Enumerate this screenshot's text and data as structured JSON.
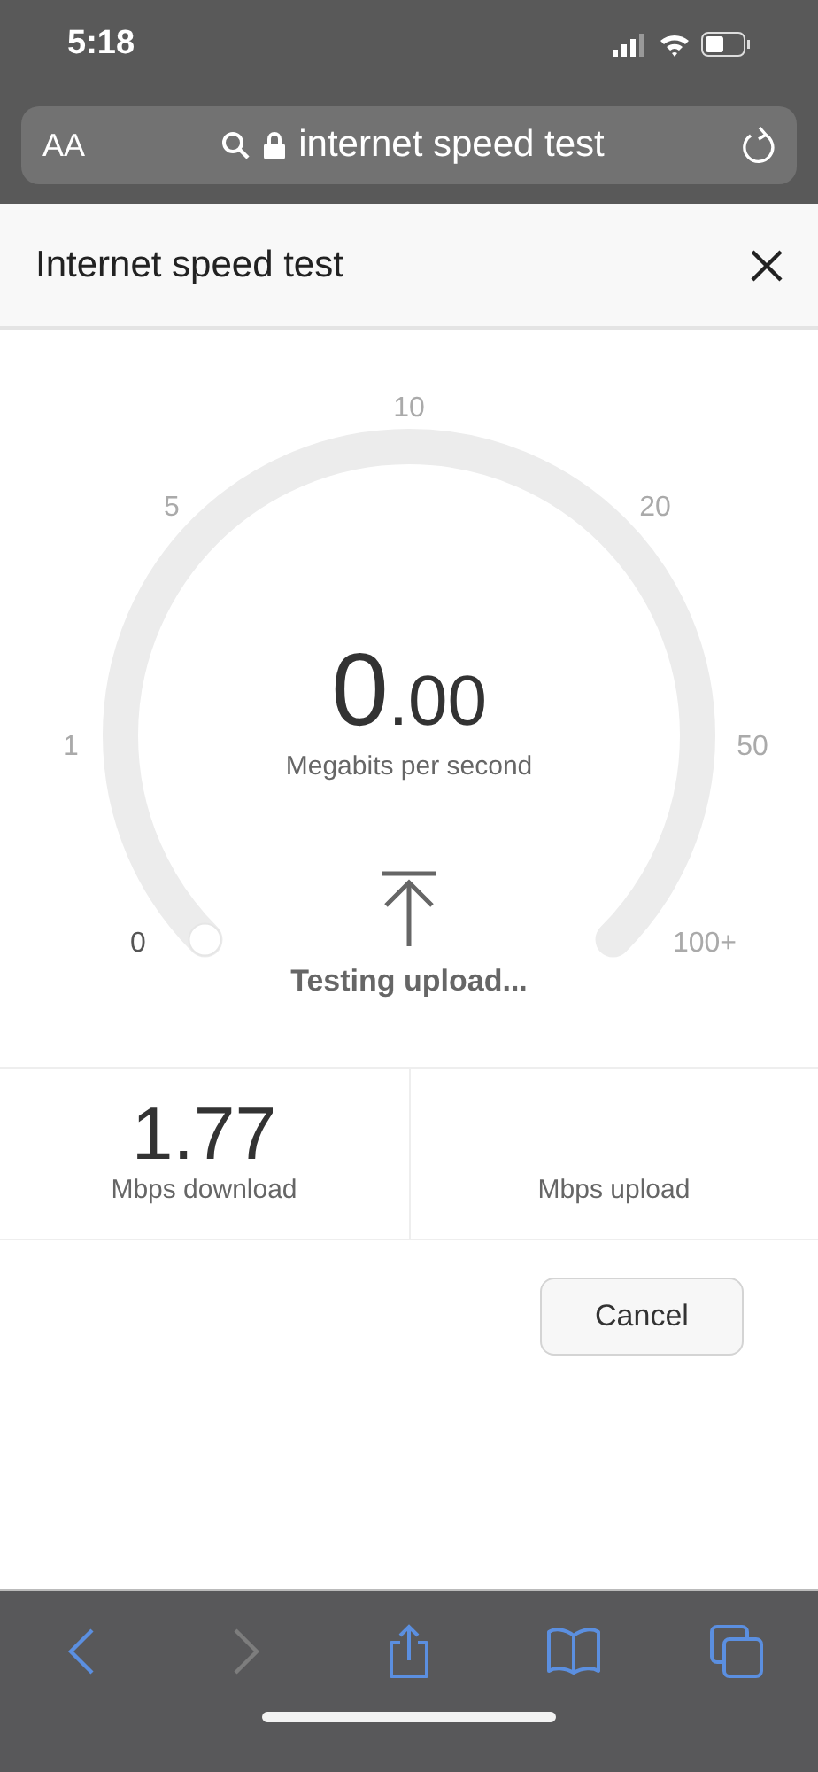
{
  "status_bar": {
    "time": "5:18"
  },
  "address_bar": {
    "text_size": "AA",
    "url": "internet speed test"
  },
  "header": {
    "title": "Internet speed test"
  },
  "gauge": {
    "ticks": [
      "0",
      "1",
      "5",
      "10",
      "20",
      "50",
      "100+"
    ],
    "reading_whole": "0",
    "reading_fraction": ".00",
    "unit": "Megabits per second",
    "status": "Testing upload..."
  },
  "results": [
    {
      "value": "1.77",
      "label": "Mbps download"
    },
    {
      "label": "Mbps upload"
    }
  ],
  "cancel_button": "Cancel",
  "toolbar": [
    {
      "kind": "back",
      "disabled": false
    },
    {
      "kind": "forward",
      "disabled": true
    },
    {
      "kind": "share",
      "disabled": false
    },
    {
      "kind": "bookmarks",
      "disabled": false
    },
    {
      "kind": "tabs",
      "disabled": false
    }
  ]
}
